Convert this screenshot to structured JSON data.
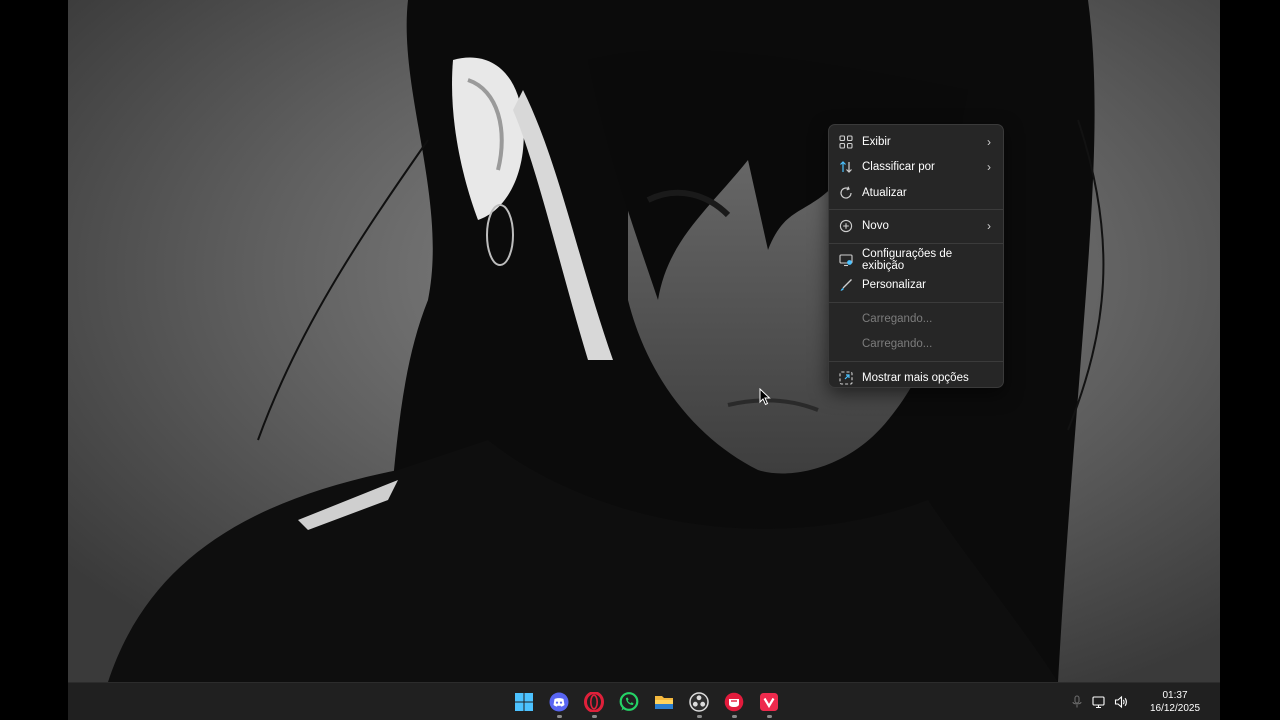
{
  "context_menu": {
    "items": [
      {
        "label": "Exibir",
        "icon": "grid-view-icon",
        "submenu": true,
        "enabled": true
      },
      {
        "label": "Classificar por",
        "icon": "sort-arrows-icon",
        "submenu": true,
        "enabled": true
      },
      {
        "label": "Atualizar",
        "icon": "refresh-icon",
        "submenu": false,
        "enabled": true
      },
      {
        "label": "Novo",
        "icon": "plus-circle-icon",
        "submenu": true,
        "enabled": true
      },
      {
        "label": "Configurações de exibição",
        "icon": "display-settings-icon",
        "submenu": false,
        "enabled": true
      },
      {
        "label": "Personalizar",
        "icon": "brush-icon",
        "submenu": false,
        "enabled": true
      },
      {
        "label": "Carregando...",
        "icon": "",
        "submenu": false,
        "enabled": false
      },
      {
        "label": "Carregando...",
        "icon": "",
        "submenu": false,
        "enabled": false
      },
      {
        "label": "Mostrar mais opções",
        "icon": "more-options-icon",
        "submenu": false,
        "enabled": true
      }
    ],
    "arrow_glyph": "›"
  },
  "taskbar": {
    "apps": [
      {
        "name": "start-button",
        "icon": "windows-logo-icon"
      },
      {
        "name": "discord-app",
        "icon": "discord-icon"
      },
      {
        "name": "opera-app",
        "icon": "opera-icon"
      },
      {
        "name": "whatsapp-app",
        "icon": "whatsapp-icon"
      },
      {
        "name": "file-explorer-app",
        "icon": "folder-icon"
      },
      {
        "name": "obs-app",
        "icon": "obs-icon"
      },
      {
        "name": "red-app",
        "icon": "red-app-icon"
      },
      {
        "name": "pink-app",
        "icon": "pink-app-icon"
      }
    ],
    "clock": {
      "time": "01:37",
      "date": "16/12/2025"
    }
  },
  "colors": {
    "menu_bg": "#262626",
    "taskbar_bg": "#202020",
    "accent_blue": "#4cc2ff",
    "discord": "#5865f2",
    "opera": "#e0203a",
    "whatsapp": "#25d366",
    "folder": "#f4b83e"
  }
}
